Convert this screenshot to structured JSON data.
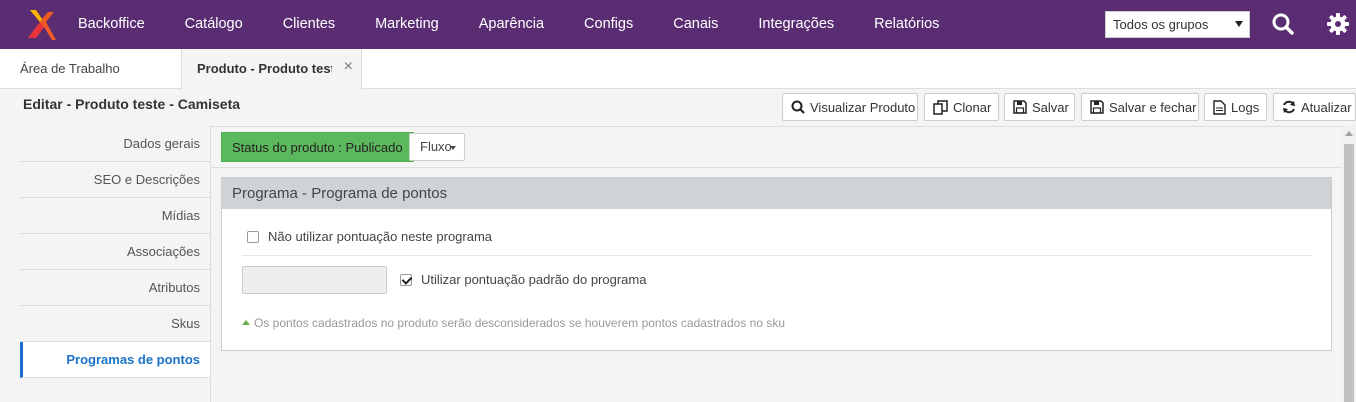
{
  "nav": {
    "items": [
      "Backoffice",
      "Catálogo",
      "Clientes",
      "Marketing",
      "Aparência",
      "Configs",
      "Canais",
      "Integrações",
      "Relatórios"
    ],
    "group_select": "Todos os grupos",
    "icons": [
      "logo-icon",
      "search-icon",
      "gear-icon"
    ],
    "bg_color": "#5a2d73"
  },
  "tabs": {
    "home": "Área de Trabalho",
    "active": "Produto - Produto teste - Camiseta",
    "close": "×"
  },
  "page": {
    "title": "Editar - Produto teste - Camiseta"
  },
  "toolbar": {
    "view": "Visualizar Produto",
    "clone": "Clonar",
    "save": "Salvar",
    "save_close": "Salvar e fechar",
    "logs": "Logs",
    "refresh": "Atualizar"
  },
  "sidebar": {
    "items": [
      "Dados gerais",
      "SEO e Descrições",
      "Mídias",
      "Associações",
      "Atributos",
      "Skus",
      "Programas de pontos"
    ],
    "active": "Programas de pontos",
    "accent_color": "#1a73c8"
  },
  "content": {
    "status": "Status do produto : Publicado",
    "status_color": "#5cb85c",
    "flow_button": "Fluxo",
    "panel_title": "Programa - Programa de pontos",
    "no_points_label": "Não utilizar pontuação neste programa",
    "no_points_checked": false,
    "default_points_label": "Utilizar pontuação padrão do programa",
    "default_points_checked": true,
    "points_value": "",
    "hint": "Os pontos cadastrados no produto serão desconsiderados se houverem pontos cadastrados no sku"
  }
}
